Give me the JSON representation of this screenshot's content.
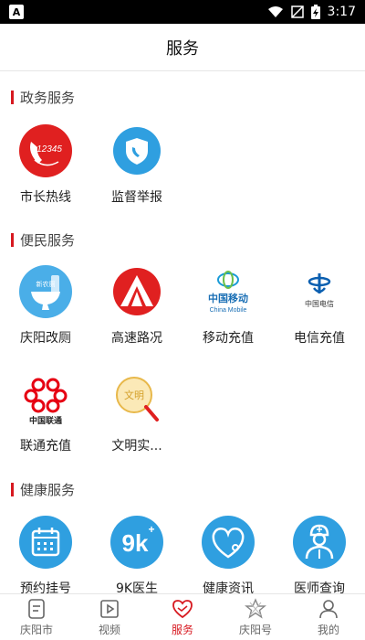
{
  "status_bar": {
    "time": "3:17",
    "app_badge": "A"
  },
  "header": {
    "title": "服务"
  },
  "sections": [
    {
      "title": "政务服务",
      "items": [
        {
          "label": "市长热线",
          "icon_text": "12345"
        },
        {
          "label": "监督举报"
        }
      ]
    },
    {
      "title": "便民服务",
      "items": [
        {
          "label": "庆阳改厕",
          "icon_text": "新农厕"
        },
        {
          "label": "高速路况"
        },
        {
          "label": "移动充值",
          "icon_text": "中国移动",
          "icon_text_en": "China Mobile"
        },
        {
          "label": "电信充值",
          "icon_text": "中国电信"
        },
        {
          "label": "联通充值",
          "icon_text": "中国联通"
        },
        {
          "label": "文明实...",
          "icon_text": "文明"
        }
      ]
    },
    {
      "title": "健康服务",
      "items": [
        {
          "label": "预约挂号"
        },
        {
          "label": "9K医生",
          "icon_text": "9k",
          "icon_sup": "+"
        },
        {
          "label": "健康资讯"
        },
        {
          "label": "医师查询"
        }
      ]
    }
  ],
  "tabs": [
    {
      "label": "庆阳市",
      "icon": "document-icon",
      "active": false
    },
    {
      "label": "视频",
      "icon": "video-icon",
      "active": false
    },
    {
      "label": "服务",
      "icon": "handshake-icon",
      "active": true
    },
    {
      "label": "庆阳号",
      "icon": "star-icon",
      "active": false
    },
    {
      "label": "我的",
      "icon": "person-icon",
      "active": false
    }
  ],
  "colors": {
    "accent": "#d71920",
    "health_blue": "#2f9fe0",
    "mobile_blue": "#1a6fb5"
  }
}
